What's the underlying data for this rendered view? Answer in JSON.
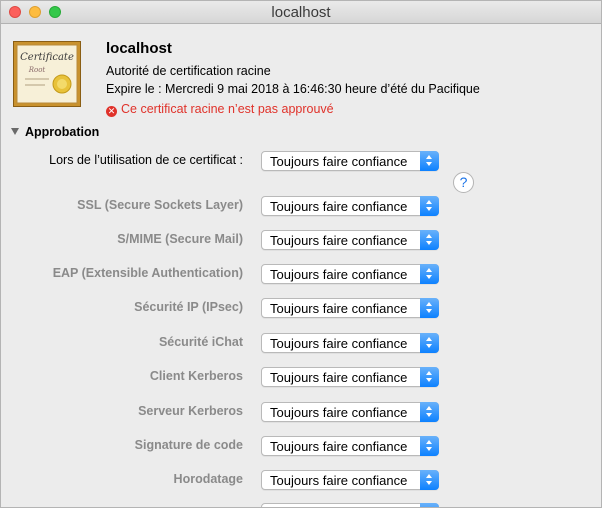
{
  "window": {
    "title": "localhost"
  },
  "certificate": {
    "name": "localhost",
    "kind": "Autorité de certification racine",
    "expiry": "Expire le : Mercredi 9 mai 2018 à 16:46:30 heure d’été du Pacifique",
    "status": "Ce certificat racine n’est pas approuvé",
    "icon_text_1": "Certificate",
    "icon_text_2": "Root"
  },
  "trust": {
    "section_title": "Approbation",
    "main_label": "Lors de l’utilisation de ce certificat :",
    "main_value": "Toujours faire confiance",
    "help_symbol": "?",
    "rows": [
      {
        "label": "SSL (Secure Sockets Layer)",
        "value": "Toujours faire confiance"
      },
      {
        "label": "S/MIME (Secure Mail)",
        "value": "Toujours faire confiance"
      },
      {
        "label": "EAP (Extensible Authentication)",
        "value": "Toujours faire confiance"
      },
      {
        "label": "Sécurité IP (IPsec)",
        "value": "Toujours faire confiance"
      },
      {
        "label": "Sécurité iChat",
        "value": "Toujours faire confiance"
      },
      {
        "label": "Client Kerberos",
        "value": "Toujours faire confiance"
      },
      {
        "label": "Serveur Kerberos",
        "value": "Toujours faire confiance"
      },
      {
        "label": "Signature de code",
        "value": "Toujours faire confiance"
      },
      {
        "label": "Horodatage",
        "value": "Toujours faire confiance"
      }
    ]
  },
  "colors": {
    "error_red": "#e0322a",
    "popup_accent": "#0d81ff",
    "label_gray": "#8a8a8a"
  }
}
